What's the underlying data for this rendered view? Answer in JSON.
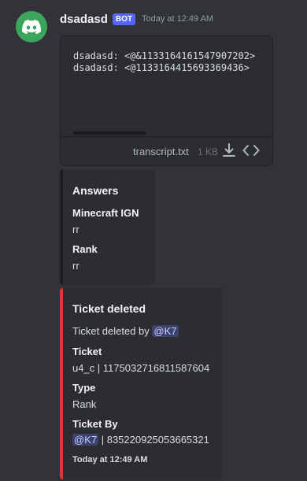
{
  "message": {
    "username": "dsadasd",
    "badge": "BOT",
    "timestamp": "Today at 12:49 AM",
    "avatar_icon": "discord-logo-icon",
    "avatar_color": "#3ba55c"
  },
  "attachment": {
    "lines": [
      "dsadasd: <@&1133164161547907202>",
      "dsadasd: <@1133164415693369436>"
    ],
    "filename": "transcript.txt",
    "filesize": "1 KB",
    "icons": [
      "download-icon",
      "code-icon"
    ]
  },
  "embed1": {
    "title": "Answers",
    "fields": [
      {
        "name": "Minecraft IGN",
        "value": "rr"
      },
      {
        "name": "Rank",
        "value": "rr"
      }
    ]
  },
  "embed2": {
    "accent_color": "#da373c",
    "title": "Ticket deleted",
    "description_prefix": "Ticket deleted by ",
    "description_mention": "@K7",
    "fields": [
      {
        "name": "Ticket",
        "value": "u4_c | 1175032716811587604"
      },
      {
        "name": "Type",
        "value": "Rank"
      },
      {
        "name": "Ticket By",
        "mention": "@K7",
        "value": " | 835220925053665321"
      }
    ],
    "footer": "Today at 12:49 AM"
  }
}
